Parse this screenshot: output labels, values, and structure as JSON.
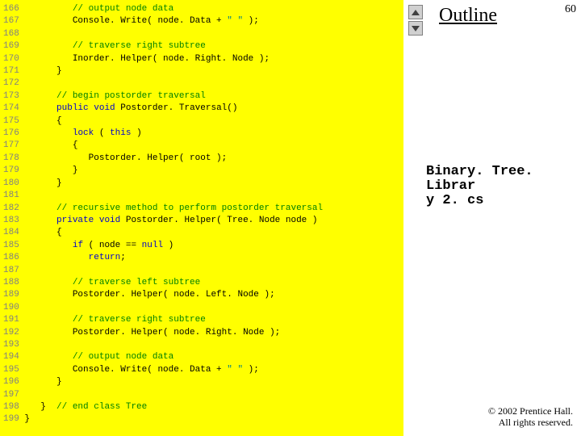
{
  "page_number": "60",
  "outline_label": "Outline",
  "filename_l1": "Binary. Tree. Librar",
  "filename_l2": "y 2. cs",
  "copyright_l1": "© 2002 Prentice Hall.",
  "copyright_l2": "All rights reserved.",
  "code": [
    {
      "n": "166",
      "seg": [
        {
          "c": "cm",
          "t": "         // output node data"
        }
      ]
    },
    {
      "n": "167",
      "seg": [
        {
          "c": "",
          "t": "         Console. Write( node. Data + "
        },
        {
          "c": "str",
          "t": "\" \""
        },
        {
          "c": "",
          "t": " );"
        }
      ]
    },
    {
      "n": "168",
      "seg": [
        {
          "c": "",
          "t": ""
        }
      ]
    },
    {
      "n": "169",
      "seg": [
        {
          "c": "cm",
          "t": "         // traverse right subtree"
        }
      ]
    },
    {
      "n": "170",
      "seg": [
        {
          "c": "",
          "t": "         Inorder. Helper( node. Right. Node );"
        }
      ]
    },
    {
      "n": "171",
      "seg": [
        {
          "c": "",
          "t": "      }"
        }
      ]
    },
    {
      "n": "172",
      "seg": [
        {
          "c": "",
          "t": ""
        }
      ]
    },
    {
      "n": "173",
      "seg": [
        {
          "c": "cm",
          "t": "      // begin postorder traversal"
        }
      ]
    },
    {
      "n": "174",
      "seg": [
        {
          "c": "",
          "t": "      "
        },
        {
          "c": "kw",
          "t": "public void"
        },
        {
          "c": "",
          "t": " Postorder. Traversal()"
        }
      ]
    },
    {
      "n": "175",
      "seg": [
        {
          "c": "",
          "t": "      {"
        }
      ]
    },
    {
      "n": "176",
      "seg": [
        {
          "c": "",
          "t": "         "
        },
        {
          "c": "kw",
          "t": "lock"
        },
        {
          "c": "",
          "t": " ( "
        },
        {
          "c": "kw",
          "t": "this"
        },
        {
          "c": "",
          "t": " )"
        }
      ]
    },
    {
      "n": "177",
      "seg": [
        {
          "c": "",
          "t": "         {"
        }
      ]
    },
    {
      "n": "178",
      "seg": [
        {
          "c": "",
          "t": "            Postorder. Helper( root );"
        }
      ]
    },
    {
      "n": "179",
      "seg": [
        {
          "c": "",
          "t": "         }"
        }
      ]
    },
    {
      "n": "180",
      "seg": [
        {
          "c": "",
          "t": "      }"
        }
      ]
    },
    {
      "n": "181",
      "seg": [
        {
          "c": "",
          "t": ""
        }
      ]
    },
    {
      "n": "182",
      "seg": [
        {
          "c": "cm",
          "t": "      // recursive method to perform postorder traversal"
        }
      ]
    },
    {
      "n": "183",
      "seg": [
        {
          "c": "",
          "t": "      "
        },
        {
          "c": "kw",
          "t": "private void"
        },
        {
          "c": "",
          "t": " Postorder. Helper( Tree. Node node )"
        }
      ]
    },
    {
      "n": "184",
      "seg": [
        {
          "c": "",
          "t": "      {"
        }
      ]
    },
    {
      "n": "185",
      "seg": [
        {
          "c": "",
          "t": "         "
        },
        {
          "c": "kw",
          "t": "if"
        },
        {
          "c": "",
          "t": " ( node == "
        },
        {
          "c": "kw",
          "t": "null"
        },
        {
          "c": "",
          "t": " )"
        }
      ]
    },
    {
      "n": "186",
      "seg": [
        {
          "c": "",
          "t": "            "
        },
        {
          "c": "kw",
          "t": "return"
        },
        {
          "c": "",
          "t": ";"
        }
      ]
    },
    {
      "n": "187",
      "seg": [
        {
          "c": "",
          "t": ""
        }
      ]
    },
    {
      "n": "188",
      "seg": [
        {
          "c": "cm",
          "t": "         // traverse left subtree"
        }
      ]
    },
    {
      "n": "189",
      "seg": [
        {
          "c": "",
          "t": "         Postorder. Helper( node. Left. Node );"
        }
      ]
    },
    {
      "n": "190",
      "seg": [
        {
          "c": "",
          "t": ""
        }
      ]
    },
    {
      "n": "191",
      "seg": [
        {
          "c": "cm",
          "t": "         // traverse right subtree"
        }
      ]
    },
    {
      "n": "192",
      "seg": [
        {
          "c": "",
          "t": "         Postorder. Helper( node. Right. Node );"
        }
      ]
    },
    {
      "n": "193",
      "seg": [
        {
          "c": "",
          "t": ""
        }
      ]
    },
    {
      "n": "194",
      "seg": [
        {
          "c": "cm",
          "t": "         // output node data"
        }
      ]
    },
    {
      "n": "195",
      "seg": [
        {
          "c": "",
          "t": "         Console. Write( node. Data + "
        },
        {
          "c": "str",
          "t": "\" \""
        },
        {
          "c": "",
          "t": " );"
        }
      ]
    },
    {
      "n": "196",
      "seg": [
        {
          "c": "",
          "t": "      }"
        }
      ]
    },
    {
      "n": "197",
      "seg": [
        {
          "c": "",
          "t": ""
        }
      ]
    },
    {
      "n": "198",
      "seg": [
        {
          "c": "",
          "t": "   }  "
        },
        {
          "c": "cm",
          "t": "// end class Tree"
        }
      ]
    },
    {
      "n": "199",
      "seg": [
        {
          "c": "",
          "t": "}"
        }
      ]
    }
  ]
}
